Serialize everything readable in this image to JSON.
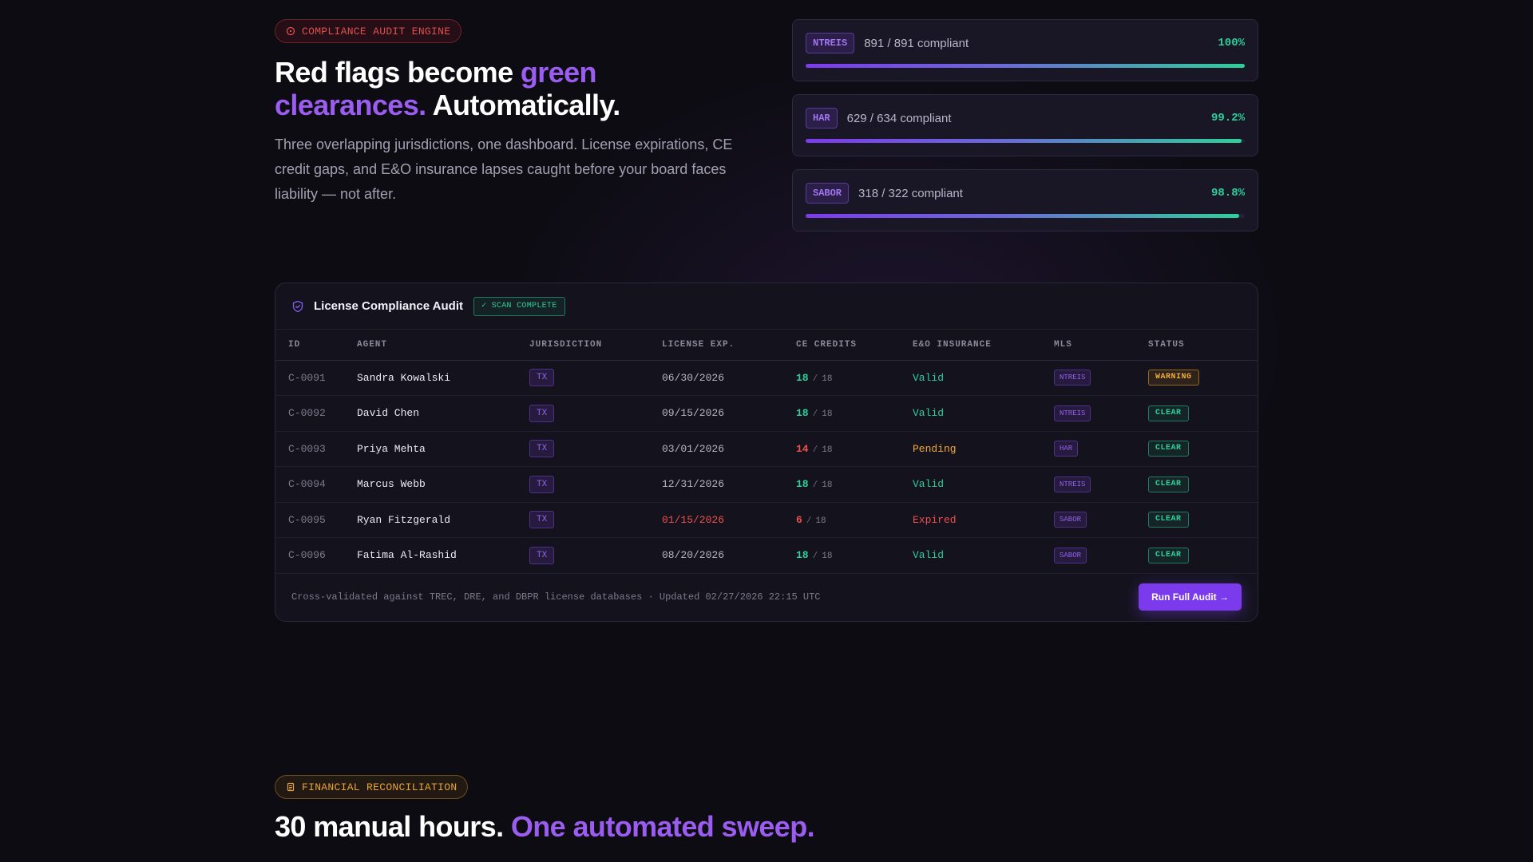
{
  "hero": {
    "badge": "COMPLIANCE AUDIT ENGINE",
    "title_1": "Red flags become ",
    "title_accent": "green clearances.",
    "title_2": " Automatically.",
    "description": "Three overlapping jurisdictions, one dashboard. License expirations, CE credit gaps, and E&O insurance lapses caught before your board faces liability — not after."
  },
  "jurisdictions": [
    {
      "tag": "NTREIS",
      "count": "891 / 891 compliant",
      "percent": "100%",
      "fill": 1.0
    },
    {
      "tag": "HAR",
      "count": "629 / 634 compliant",
      "percent": "99.2%",
      "fill": 0.992
    },
    {
      "tag": "SABOR",
      "count": "318 / 322 compliant",
      "percent": "98.8%",
      "fill": 0.988
    }
  ],
  "audit": {
    "title": "License Compliance Audit",
    "scan_status": "✓ SCAN COMPLETE",
    "columns": [
      "ID",
      "AGENT",
      "JURISDICTION",
      "LICENSE EXP.",
      "CE CREDITS",
      "E&O INSURANCE",
      "MLS",
      "STATUS"
    ],
    "rows": [
      {
        "id": "C-0091",
        "agent": "Sandra Kowalski",
        "jurisdiction": "TX",
        "license_exp": "06/30/2026",
        "license_state": "ok",
        "ce_have": "18",
        "ce_sep": "/",
        "ce_req": "18",
        "ce_state": "ok",
        "eo": "Valid",
        "eo_state": "valid",
        "mls": "NTREIS",
        "status": "WARNING",
        "status_state": "warning"
      },
      {
        "id": "C-0092",
        "agent": "David Chen",
        "jurisdiction": "TX",
        "license_exp": "09/15/2026",
        "license_state": "ok",
        "ce_have": "18",
        "ce_sep": "/",
        "ce_req": "18",
        "ce_state": "ok",
        "eo": "Valid",
        "eo_state": "valid",
        "mls": "NTREIS",
        "status": "CLEAR",
        "status_state": "clear"
      },
      {
        "id": "C-0093",
        "agent": "Priya Mehta",
        "jurisdiction": "TX",
        "license_exp": "03/01/2026",
        "license_state": "ok",
        "ce_have": "14",
        "ce_sep": "/",
        "ce_req": "18",
        "ce_state": "bad",
        "eo": "Pending",
        "eo_state": "pending",
        "mls": "HAR",
        "status": "CLEAR",
        "status_state": "clear"
      },
      {
        "id": "C-0094",
        "agent": "Marcus Webb",
        "jurisdiction": "TX",
        "license_exp": "12/31/2026",
        "license_state": "ok",
        "ce_have": "18",
        "ce_sep": "/",
        "ce_req": "18",
        "ce_state": "ok",
        "eo": "Valid",
        "eo_state": "valid",
        "mls": "NTREIS",
        "status": "CLEAR",
        "status_state": "clear"
      },
      {
        "id": "C-0095",
        "agent": "Ryan Fitzgerald",
        "jurisdiction": "TX",
        "license_exp": "01/15/2026",
        "license_state": "expired",
        "ce_have": "6",
        "ce_sep": "/",
        "ce_req": "18",
        "ce_state": "bad",
        "eo": "Expired",
        "eo_state": "expired",
        "mls": "SABOR",
        "status": "CLEAR",
        "status_state": "clear"
      },
      {
        "id": "C-0096",
        "agent": "Fatima Al-Rashid",
        "jurisdiction": "TX",
        "license_exp": "08/20/2026",
        "license_state": "ok",
        "ce_have": "18",
        "ce_sep": "/",
        "ce_req": "18",
        "ce_state": "ok",
        "eo": "Valid",
        "eo_state": "valid",
        "mls": "SABOR",
        "status": "CLEAR",
        "status_state": "clear"
      }
    ],
    "footer_note": "Cross-validated against TREC, DRE, and DBPR license databases · Updated 02/27/2026 22:15 UTC",
    "action_label": "Run Full Audit →"
  },
  "section2": {
    "badge": "FINANCIAL RECONCILIATION",
    "title_1": "30 manual hours. ",
    "title_accent": "One automated sweep."
  },
  "colors": {
    "accent": "#7c3aed",
    "success": "#2fcf9a",
    "warning": "#f0a93a",
    "danger": "#ef4e4e"
  },
  "icons": {
    "hero_badge": "alert-circle-icon",
    "audit_title": "shield-icon",
    "section2_badge": "document-icon"
  }
}
